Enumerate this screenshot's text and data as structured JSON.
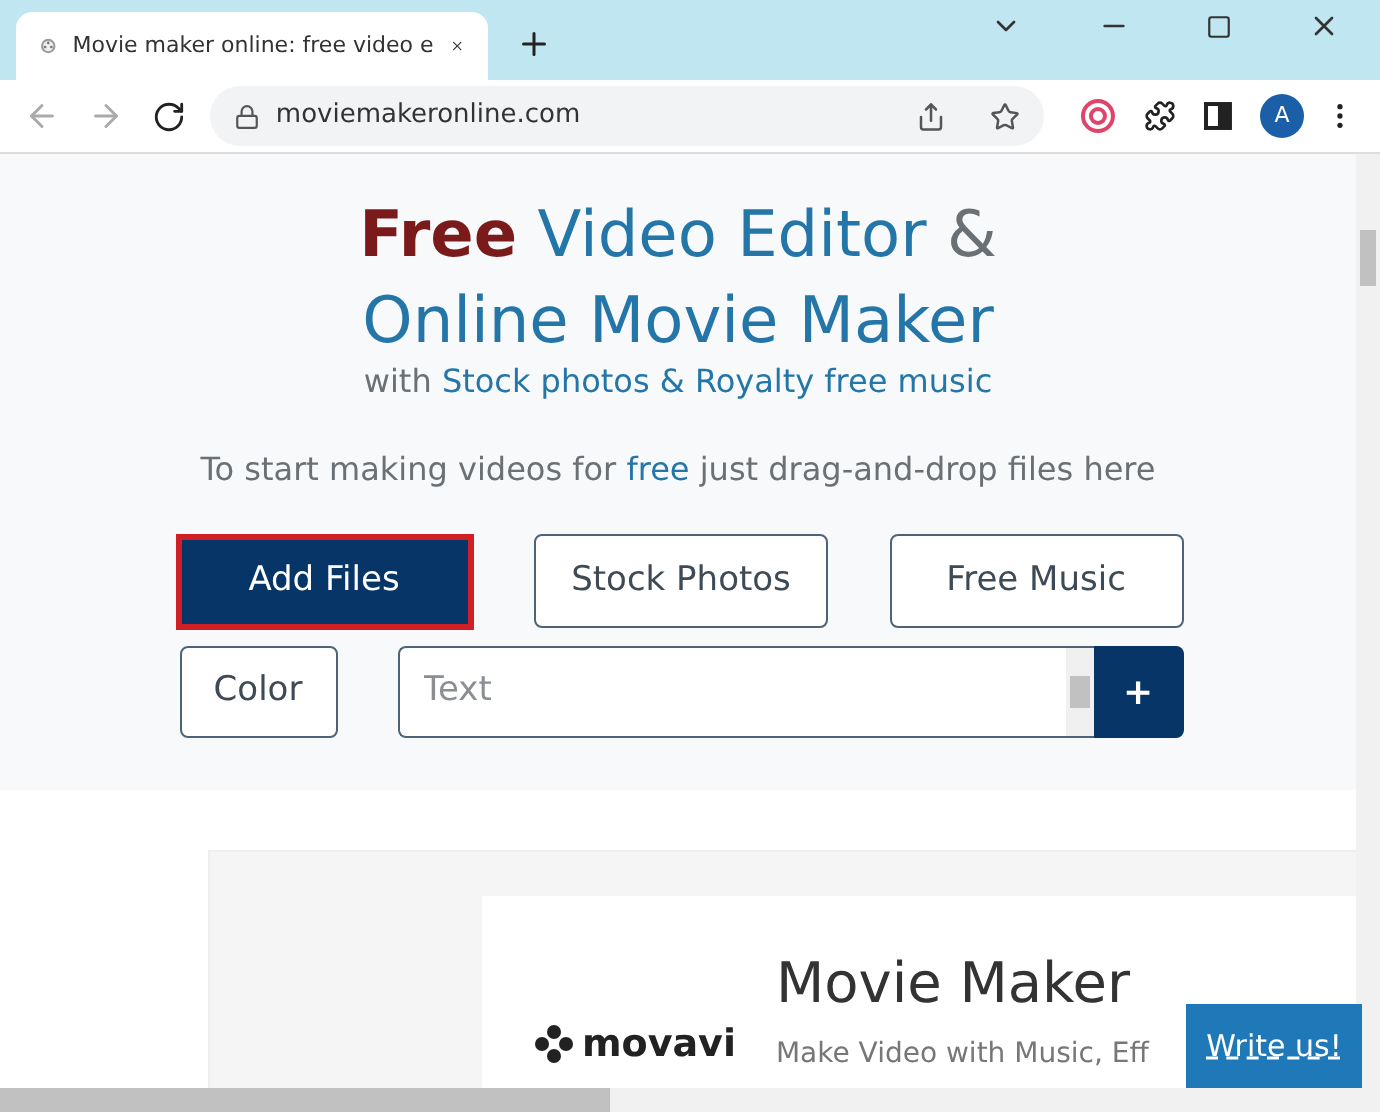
{
  "browser": {
    "tab": {
      "title": "Movie maker online: free video e",
      "selected": true
    },
    "address": "moviemakeronline.com",
    "avatar": "A"
  },
  "hero": {
    "title_line1": [
      {
        "text": "Free",
        "kind": "highlight"
      },
      {
        "text": "Video Editor",
        "kind": "accent"
      },
      {
        "text": "&",
        "kind": "plain"
      }
    ],
    "title_line2": "Online Movie Maker",
    "subtitle": [
      {
        "text": "with",
        "kind": "plain"
      },
      {
        "text": "Stock photos & Royalty free music",
        "kind": "accent"
      }
    ],
    "prompt": [
      {
        "text": "To start making videos for",
        "kind": "plain"
      },
      {
        "text": "free",
        "kind": "accent"
      },
      {
        "text": "just drag-and-drop files here",
        "kind": "plain"
      }
    ]
  },
  "buttons": [
    {
      "label": "Add Files",
      "kind": "primary"
    },
    {
      "label": "Stock Photos",
      "kind": "outline"
    },
    {
      "label": "Free Music",
      "kind": "outline"
    }
  ],
  "color_button": "Color",
  "text_field": {
    "placeholder": "Text"
  },
  "add_button": "+",
  "card": {
    "logo": "movavi",
    "title": "Movie Maker",
    "subtitle": "Make Video with Music, Eff"
  },
  "write_us": "Write us!"
}
